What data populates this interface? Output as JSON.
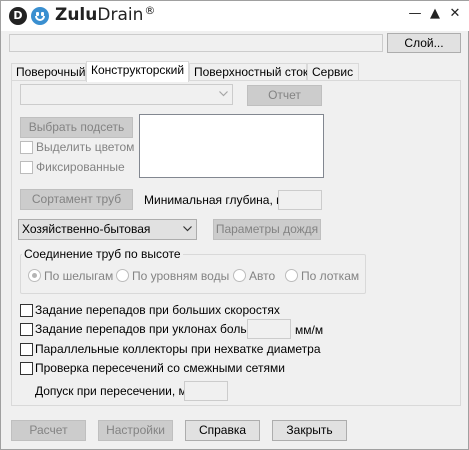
{
  "app": {
    "title_bold": "Zulu",
    "title_rest": "Drain",
    "title_reg": "®",
    "logo_letter": "D",
    "controls": {
      "minimize": "—",
      "maximize": "▲",
      "close": "✕"
    }
  },
  "toolbar": {
    "layer_input_value": "",
    "layer_button": "Слой..."
  },
  "tabs": [
    {
      "label": "Поверочный"
    },
    {
      "label": "Конструкторский"
    },
    {
      "label": "Поверхностный сток"
    },
    {
      "label": "Сервис"
    }
  ],
  "constructor": {
    "variant_combo_value": "",
    "report_button": "Отчет",
    "select_subnet_button": "Выбрать подсеть",
    "highlight_color_label": "Выделить цветом",
    "fixed_label": "Фиксированные",
    "pipe_assortment_button": "Сортамент труб",
    "min_depth_label": "Минимальная глубина, м:",
    "min_depth_value": "",
    "sewer_type_value": "Хозяйственно-бытовая",
    "rain_params_button": "Параметры дождя",
    "pipe_connection": {
      "title": "Соединение труб по высоте",
      "options": [
        {
          "label": "По шелыгам",
          "checked": true
        },
        {
          "label": "По уровням воды",
          "checked": false
        },
        {
          "label": "Авто",
          "checked": false
        },
        {
          "label": "По лоткам",
          "checked": false
        }
      ]
    },
    "options": {
      "drops_high_speed": "Задание перепадов при больших скоростях",
      "drops_slopes": "Задание перепадов при уклонах больше",
      "drops_slopes_value": "",
      "drops_slopes_unit": "мм/м",
      "parallel_collectors": "Параллельные коллекторы при нехватке диаметра",
      "check_intersections": "Проверка пересечений со смежными сетями",
      "tolerance_label": "Допуск при пересечении, м:",
      "tolerance_value": ""
    }
  },
  "footer": {
    "calc": "Расчет",
    "settings": "Настройки",
    "help": "Справка",
    "close": "Закрыть"
  }
}
